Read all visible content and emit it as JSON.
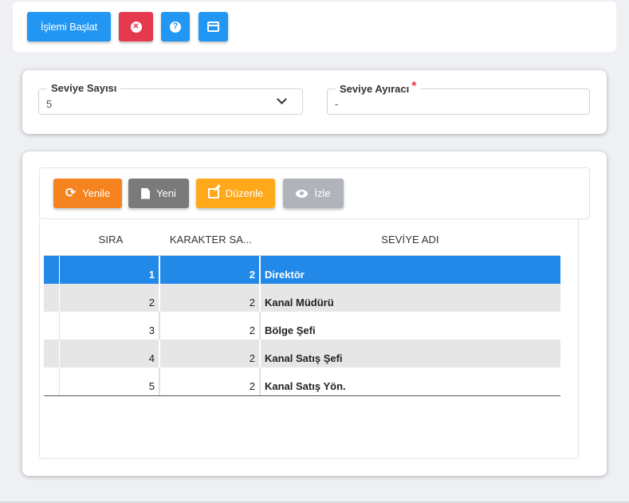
{
  "toolbar": {
    "start_label": "İşlemi Başlat",
    "cancel_icon": "close-circle-icon",
    "help_icon": "question-circle-icon",
    "window_icon": "window-icon",
    "help_glyph": "?",
    "cancel_glyph": "✕"
  },
  "level_form": {
    "count_label": "Seviye Sayısı",
    "count_value": "5",
    "separator_label": "Seviye Ayıracı",
    "separator_required": "*",
    "separator_value": "-"
  },
  "grid_toolbar": {
    "refresh_label": "Yenile",
    "refresh_glyph": "⟳",
    "new_label": "Yeni",
    "edit_label": "Düzenle",
    "view_label": "İzle"
  },
  "grid": {
    "columns": [
      "SIRA",
      "KARAKTER SA...",
      "SEVİYE ADI"
    ],
    "rows": [
      {
        "sira": "1",
        "karakter": "2",
        "adi": "Direktör",
        "selected": true
      },
      {
        "sira": "2",
        "karakter": "2",
        "adi": "Kanal Müdürü"
      },
      {
        "sira": "3",
        "karakter": "2",
        "adi": "Bölge Şefi"
      },
      {
        "sira": "4",
        "karakter": "2",
        "adi": "Kanal Satış Şefi"
      },
      {
        "sira": "5",
        "karakter": "2",
        "adi": "Kanal Satış Yön."
      }
    ]
  },
  "colors": {
    "primary": "#2196f3",
    "danger": "#e53950",
    "refresh": "#f58420",
    "new": "#7a7a7a",
    "edit": "#ffa91a",
    "view": "#b0b4ba",
    "selected_row": "#2289e8"
  }
}
